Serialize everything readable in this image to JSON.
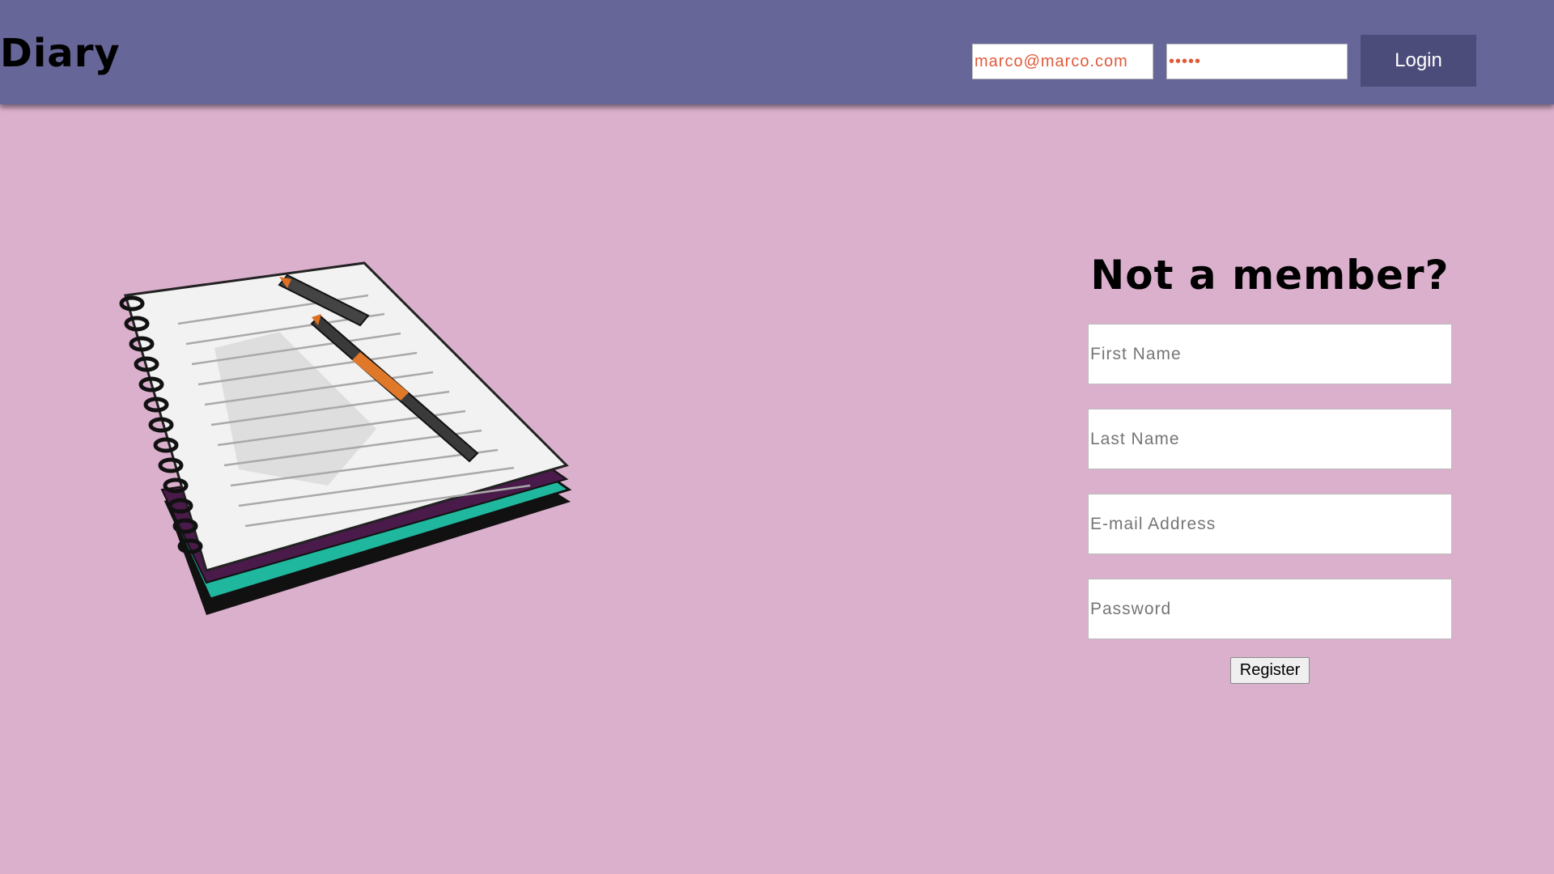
{
  "header": {
    "brand": "Diary",
    "login_email_value": "marco@marco.com",
    "login_password_value": "12345",
    "login_button_label": "Login"
  },
  "register": {
    "title": "Not a member?",
    "first_name_placeholder": "First Name",
    "last_name_placeholder": "Last Name",
    "email_placeholder": "E-mail Address",
    "password_placeholder": "Password",
    "button_label": "Register"
  },
  "colors": {
    "page_background": "#dbb0cd",
    "navbar": "#666699",
    "login_button": "#4c4c7a",
    "input_text": "#e05a3a"
  }
}
